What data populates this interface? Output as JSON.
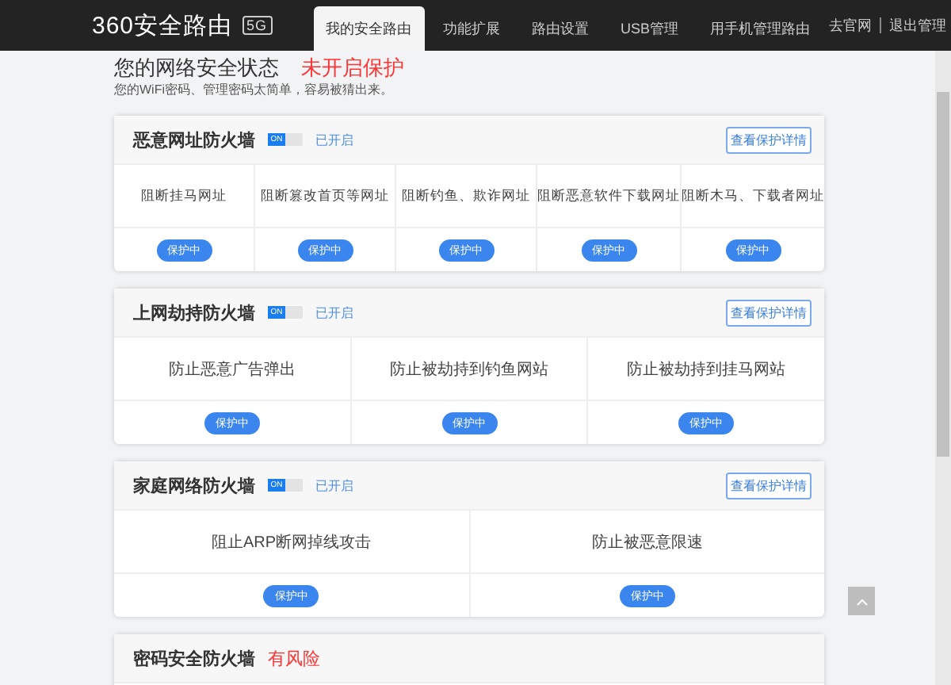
{
  "header": {
    "logo": "360安全路由",
    "logo_badge": "5G",
    "tabs": [
      {
        "label": "我的安全路由",
        "selected": true
      },
      {
        "label": "功能扩展",
        "selected": false
      },
      {
        "label": "路由设置",
        "selected": false
      },
      {
        "label": "USB管理",
        "selected": false
      },
      {
        "label": "用手机管理路由",
        "selected": false
      }
    ],
    "links": [
      "去官网",
      "退出管理"
    ]
  },
  "status": {
    "title": "您的网络安全状态",
    "state": "未开启保护",
    "note": "您的WiFi密码、管理密码太简单，容易被猜出来。"
  },
  "cards": [
    {
      "title": "恶意网址防火墙",
      "toggle": {
        "on": true,
        "label": "ON"
      },
      "status": "已开启",
      "risk": false,
      "details_button": "查看保护详情",
      "items": [
        {
          "label": "阻断挂马网址",
          "badge": "保护中"
        },
        {
          "label": "阻断篡改首页等网址",
          "badge": "保护中"
        },
        {
          "label": "阻断钓鱼、欺诈网址",
          "badge": "保护中"
        },
        {
          "label": "阻断恶意软件下载网址",
          "badge": "保护中"
        },
        {
          "label": "阻断木马、下载者网址",
          "badge": "保护中"
        }
      ]
    },
    {
      "title": "上网劫持防火墙",
      "toggle": {
        "on": true,
        "label": "ON"
      },
      "status": "已开启",
      "risk": false,
      "details_button": "查看保护详情",
      "items": [
        {
          "label": "防止恶意广告弹出",
          "badge": "保护中"
        },
        {
          "label": "防止被劫持到钓鱼网站",
          "badge": "保护中"
        },
        {
          "label": "防止被劫持到挂马网站",
          "badge": "保护中"
        }
      ]
    },
    {
      "title": "家庭网络防火墙",
      "toggle": {
        "on": true,
        "label": "ON"
      },
      "status": "已开启",
      "risk": false,
      "details_button": "查看保护详情",
      "items": [
        {
          "label": "阻止ARP断网掉线攻击",
          "badge": "保护中"
        },
        {
          "label": "防止被恶意限速",
          "badge": "保护中"
        }
      ]
    },
    {
      "title": "密码安全防火墙",
      "status": "有风险",
      "risk": true
    }
  ]
}
